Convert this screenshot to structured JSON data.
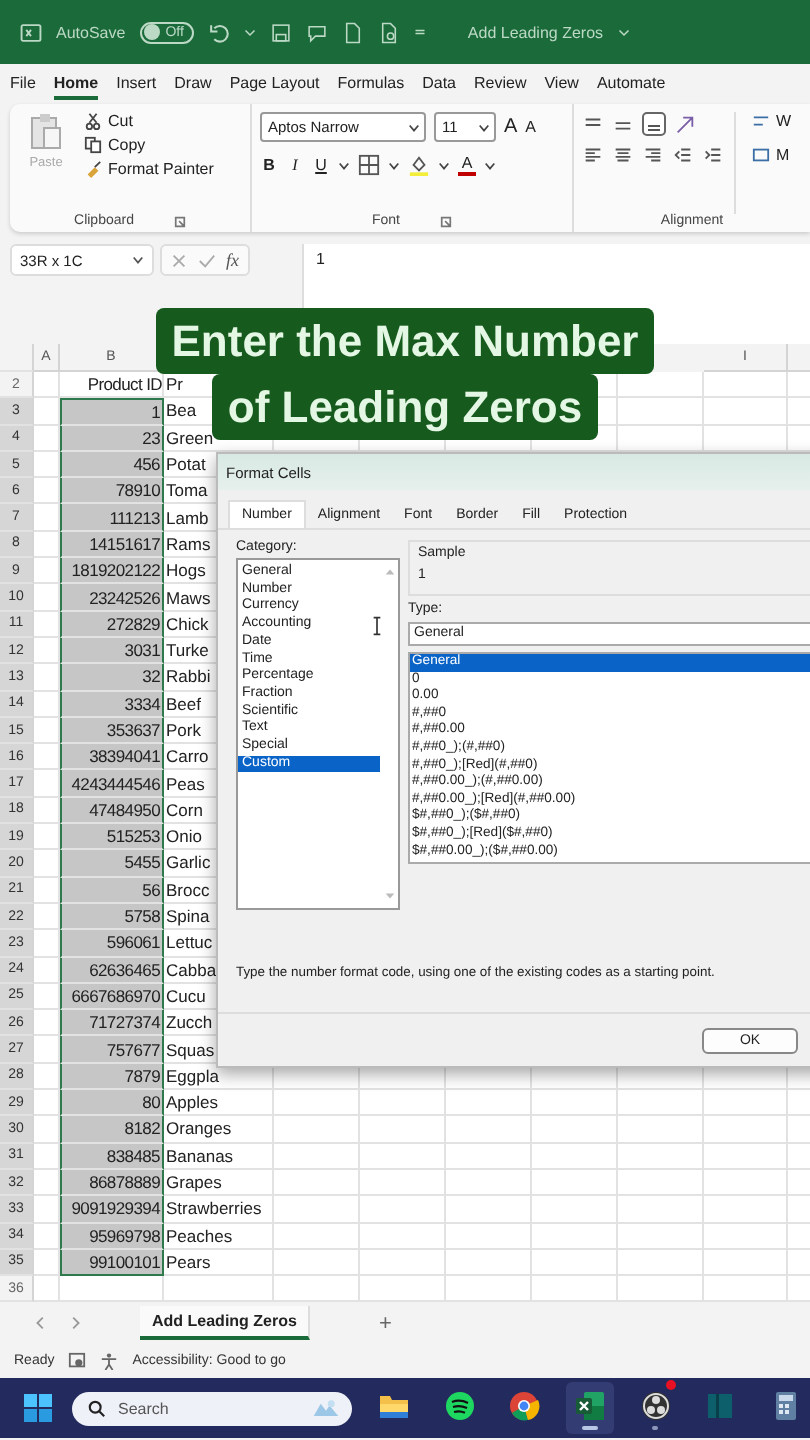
{
  "title_bar": {
    "autosave_label": "AutoSave",
    "autosave": {
      "on": false,
      "label": "Off"
    },
    "title": "Add Leading Zeros"
  },
  "ribbon_tabs": [
    {
      "label": "File",
      "selected": false
    },
    {
      "label": "Home",
      "selected": true
    },
    {
      "label": "Insert",
      "selected": false
    },
    {
      "label": "Draw",
      "selected": false
    },
    {
      "label": "Page Layout",
      "selected": false
    },
    {
      "label": "Formulas",
      "selected": false
    },
    {
      "label": "Data",
      "selected": false
    },
    {
      "label": "Review",
      "selected": false
    },
    {
      "label": "View",
      "selected": false
    },
    {
      "label": "Automate",
      "selected": false
    }
  ],
  "clipboard": {
    "paste": {
      "label": "Paste",
      "disabled": true
    },
    "cut": "Cut",
    "copy": "Copy",
    "format_painter": "Format Painter",
    "group_label": "Clipboard"
  },
  "font": {
    "name": "Aptos Narrow",
    "size": "11",
    "grow": "A",
    "shrink": "A",
    "bold": "B",
    "italic": "I",
    "underline": "U",
    "font_color": "A",
    "group_label": "Font"
  },
  "alignment": {
    "wrap_text": "W",
    "merge": "M",
    "group_label": "Alignment"
  },
  "formula_bar": {
    "name_box": "33R x 1C",
    "fx": "fx",
    "value": "1"
  },
  "column_headers": [
    "A",
    "B",
    "I"
  ],
  "rows": [
    {
      "number": "2",
      "b": "Product ID",
      "c": "Pr",
      "selected": false
    },
    {
      "number": "3",
      "b": "1",
      "c": "Bea",
      "selected": true
    },
    {
      "number": "4",
      "b": "23",
      "c": "Green",
      "selected": true
    },
    {
      "number": "5",
      "b": "456",
      "c": "Potat",
      "selected": true
    },
    {
      "number": "6",
      "b": "78910",
      "c": "Toma",
      "selected": true
    },
    {
      "number": "7",
      "b": "111213",
      "c": "Lamb",
      "selected": true
    },
    {
      "number": "8",
      "b": "14151617",
      "c": "Rams",
      "selected": true
    },
    {
      "number": "9",
      "b": "1819202122",
      "c": "Hogs",
      "selected": true
    },
    {
      "number": "10",
      "b": "23242526",
      "c": "Maws",
      "selected": true
    },
    {
      "number": "11",
      "b": "272829",
      "c": "Chick",
      "selected": true
    },
    {
      "number": "12",
      "b": "3031",
      "c": "Turke",
      "selected": true
    },
    {
      "number": "13",
      "b": "32",
      "c": "Rabbi",
      "selected": true
    },
    {
      "number": "14",
      "b": "3334",
      "c": "Beef",
      "selected": true
    },
    {
      "number": "15",
      "b": "353637",
      "c": "Pork",
      "selected": true
    },
    {
      "number": "16",
      "b": "38394041",
      "c": "Carro",
      "selected": true
    },
    {
      "number": "17",
      "b": "4243444546",
      "c": "Peas",
      "selected": true
    },
    {
      "number": "18",
      "b": "47484950",
      "c": "Corn",
      "selected": true
    },
    {
      "number": "19",
      "b": "515253",
      "c": "Onio",
      "selected": true
    },
    {
      "number": "20",
      "b": "5455",
      "c": "Garlic",
      "selected": true
    },
    {
      "number": "21",
      "b": "56",
      "c": "Brocc",
      "selected": true
    },
    {
      "number": "22",
      "b": "5758",
      "c": "Spina",
      "selected": true
    },
    {
      "number": "23",
      "b": "596061",
      "c": "Lettuc",
      "selected": true
    },
    {
      "number": "24",
      "b": "62636465",
      "c": "Cabba",
      "selected": true
    },
    {
      "number": "25",
      "b": "6667686970",
      "c": "Cucu",
      "selected": true
    },
    {
      "number": "26",
      "b": "71727374",
      "c": "Zucch",
      "selected": true
    },
    {
      "number": "27",
      "b": "757677",
      "c": "Squas",
      "selected": true
    },
    {
      "number": "28",
      "b": "7879",
      "c": "Eggpla",
      "selected": true
    },
    {
      "number": "29",
      "b": "80",
      "c": "Apples",
      "selected": true
    },
    {
      "number": "30",
      "b": "8182",
      "c": "Oranges",
      "selected": true
    },
    {
      "number": "31",
      "b": "838485",
      "c": "Bananas",
      "selected": true
    },
    {
      "number": "32",
      "b": "86878889",
      "c": "Grapes",
      "selected": true
    },
    {
      "number": "33",
      "b": "9091929394",
      "c": "Strawberries",
      "selected": true
    },
    {
      "number": "34",
      "b": "95969798",
      "c": "Peaches",
      "selected": true
    },
    {
      "number": "35",
      "b": "99100101",
      "c": "Pears",
      "selected": true
    },
    {
      "number": "36",
      "selected": false
    }
  ],
  "caption": [
    "Enter the Max Number",
    "of Leading Zeros"
  ],
  "dialog": {
    "title": "Format Cells",
    "tabs": [
      {
        "label": "Number",
        "selected": true
      },
      {
        "label": "Alignment",
        "selected": false
      },
      {
        "label": "Font",
        "selected": false
      },
      {
        "label": "Border",
        "selected": false
      },
      {
        "label": "Fill",
        "selected": false
      },
      {
        "label": "Protection",
        "selected": false
      }
    ],
    "category_label": "Category:",
    "categories": [
      {
        "label": "General",
        "selected": false
      },
      {
        "label": "Number",
        "selected": false
      },
      {
        "label": "Currency",
        "selected": false
      },
      {
        "label": "Accounting",
        "selected": false
      },
      {
        "label": "Date",
        "selected": false
      },
      {
        "label": "Time",
        "selected": false
      },
      {
        "label": "Percentage",
        "selected": false
      },
      {
        "label": "Fraction",
        "selected": false
      },
      {
        "label": "Scientific",
        "selected": false
      },
      {
        "label": "Text",
        "selected": false
      },
      {
        "label": "Special",
        "selected": false
      },
      {
        "label": "Custom",
        "selected": true
      }
    ],
    "sample_label": "Sample",
    "sample_value": "1",
    "type_label": "Type:",
    "type_value": "General",
    "types": [
      {
        "label": "General",
        "selected": true
      },
      {
        "label": "0",
        "selected": false
      },
      {
        "label": "0.00",
        "selected": false
      },
      {
        "label": "#,##0",
        "selected": false
      },
      {
        "label": "#,##0.00",
        "selected": false
      },
      {
        "label": "#,##0_);(#,##0)",
        "selected": false
      },
      {
        "label": "#,##0_);[Red](#,##0)",
        "selected": false
      },
      {
        "label": "#,##0.00_);(#,##0.00)",
        "selected": false
      },
      {
        "label": "#,##0.00_);[Red](#,##0.00)",
        "selected": false
      },
      {
        "label": "$#,##0_);($#,##0)",
        "selected": false
      },
      {
        "label": "$#,##0_);[Red]($#,##0)",
        "selected": false
      },
      {
        "label": "$#,##0.00_);($#,##0.00)",
        "selected": false
      }
    ],
    "description": "Type the number format code, using one of the existing codes as a starting point.",
    "ok": "OK"
  },
  "sheet_tabs": {
    "tabs": [
      {
        "label": "Add Leading Zeros",
        "selected": true
      }
    ],
    "add": "+"
  },
  "status_bar": {
    "ready": "Ready",
    "accessibility": "Accessibility: Good to go"
  },
  "taskbar": {
    "search_placeholder": "Search",
    "apps": [
      {
        "kind": "folder",
        "open": false,
        "focused": false,
        "badge": false
      },
      {
        "kind": "spotify",
        "open": false,
        "focused": false,
        "badge": false
      },
      {
        "kind": "chrome",
        "open": false,
        "focused": false,
        "badge": false
      },
      {
        "kind": "excel",
        "open": true,
        "focused": true,
        "badge": false
      },
      {
        "kind": "obs",
        "open": true,
        "focused": false,
        "badge": true
      },
      {
        "kind": "book",
        "open": false,
        "focused": false,
        "badge": false
      },
      {
        "kind": "calculator",
        "open": false,
        "focused": false,
        "badge": false
      }
    ]
  }
}
